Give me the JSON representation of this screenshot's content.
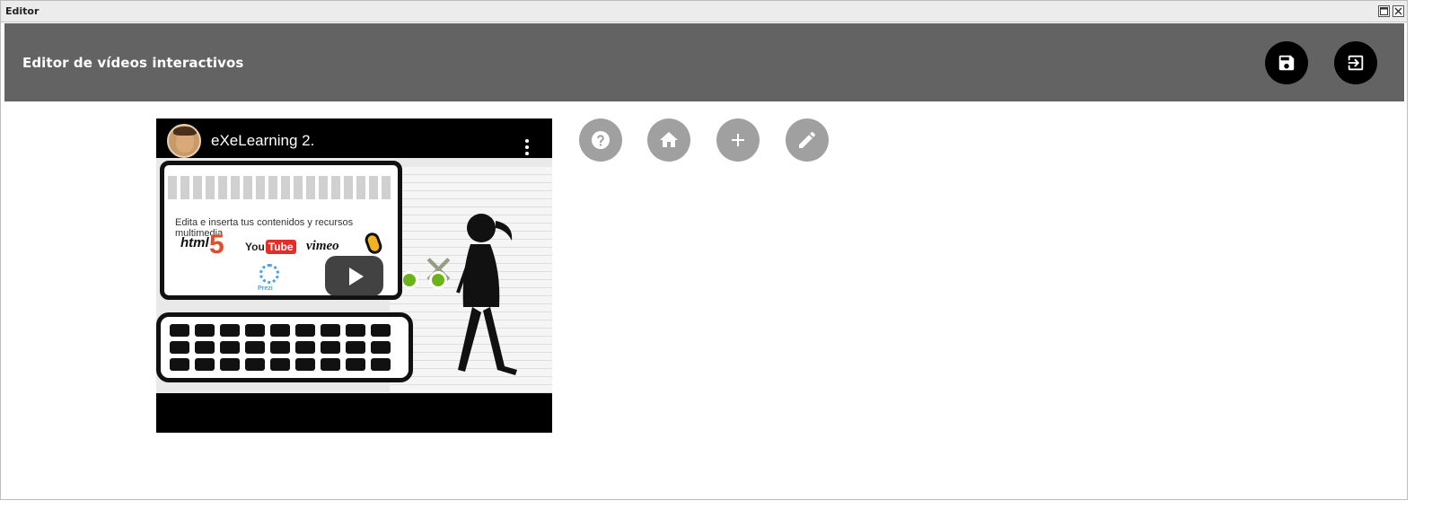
{
  "window": {
    "title": "Editor",
    "maximize_icon": "maximize-icon",
    "close_icon": "close-icon"
  },
  "header": {
    "title": "Editor de vídeos interactivos",
    "save_icon": "floppy-disk-icon",
    "exit_icon": "exit-icon",
    "background_color": "#636363"
  },
  "video": {
    "title": "eXeLearning 2.",
    "thumbnail": {
      "slogan": "Edita e inserta tus contenidos y recursos multimedia",
      "logos": [
        "html",
        "5",
        "You",
        "Tube",
        "vimeo",
        "Prezi"
      ]
    },
    "play_icon": "play-icon",
    "menu_icon": "more-vertical-icon"
  },
  "tools": [
    {
      "name": "help",
      "icon": "help-icon"
    },
    {
      "name": "home",
      "icon": "home-icon"
    },
    {
      "name": "add",
      "icon": "plus-icon"
    },
    {
      "name": "edit",
      "icon": "pencil-icon"
    }
  ],
  "colors": {
    "tool_button": "#a0a0a0",
    "header_button": "#000000"
  }
}
